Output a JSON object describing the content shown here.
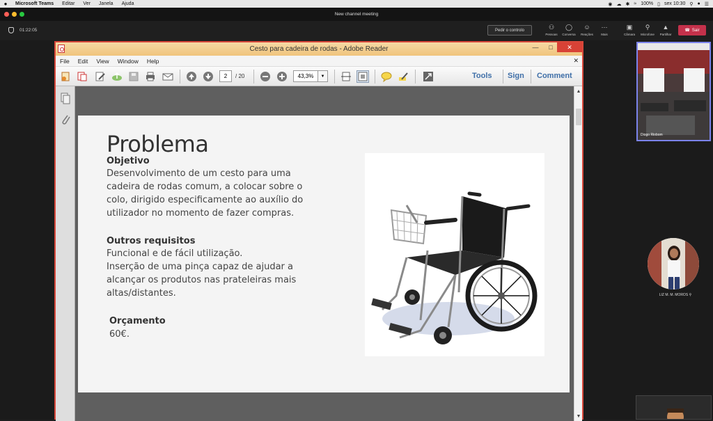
{
  "mac_menubar": {
    "app_name": "Microsoft Teams",
    "menu_items": [
      "Editar",
      "Ver",
      "Janela",
      "Ajuda"
    ],
    "battery": "100%",
    "clock": "sex 10:30"
  },
  "teams": {
    "window_title": "New channel meeting",
    "timer": "01:22:05",
    "request_control_label": "Pedir o controlo",
    "toolbar_buttons": [
      {
        "label": "Pessoas",
        "icon": "people-icon"
      },
      {
        "label": "Conversa",
        "icon": "chat-icon"
      },
      {
        "label": "Reações",
        "icon": "reactions-icon"
      },
      {
        "label": "Mais",
        "icon": "more-icon"
      },
      {
        "label": "Câmara",
        "icon": "camera-icon"
      },
      {
        "label": "Microfone",
        "icon": "microphone-icon"
      },
      {
        "label": "Partilhar",
        "icon": "share-icon"
      }
    ],
    "leave_label": "Sair",
    "participants": [
      {
        "name": "Diogo Riobom"
      },
      {
        "name": "LIZ M. M. MOROS"
      }
    ]
  },
  "reader": {
    "title": "Cesto para cadeira de rodas - Adobe Reader",
    "menu": [
      "File",
      "Edit",
      "View",
      "Window",
      "Help"
    ],
    "current_page": "2",
    "total_pages": "/ 20",
    "zoom": "43,3%",
    "panels": [
      "Tools",
      "Sign",
      "Comment"
    ]
  },
  "slide": {
    "title": "Problema",
    "objective_heading": "Objetivo",
    "objective_lines": [
      "Desenvolvimento de um cesto para uma",
      "cadeira de rodas comum, a colocar sobre o",
      "colo, dirigido especificamente ao auxílio do",
      "utilizador no momento de fazer compras."
    ],
    "requirements_heading": "Outros requisitos",
    "requirements_lines": [
      "Funcional e de fácil utilização.",
      "Inserção de uma pinça capaz de ajudar a",
      "alcançar os produtos nas prateleiras mais",
      "altas/distantes."
    ],
    "budget_heading": "Orçamento",
    "budget_value": "60€."
  },
  "colors": {
    "teams_leave": "#c4314b",
    "reader_border": "#d8473a",
    "reader_title_bg": "#f0c47c",
    "panel_link": "#3f6fa8",
    "active_tile_border": "#7b83eb"
  }
}
